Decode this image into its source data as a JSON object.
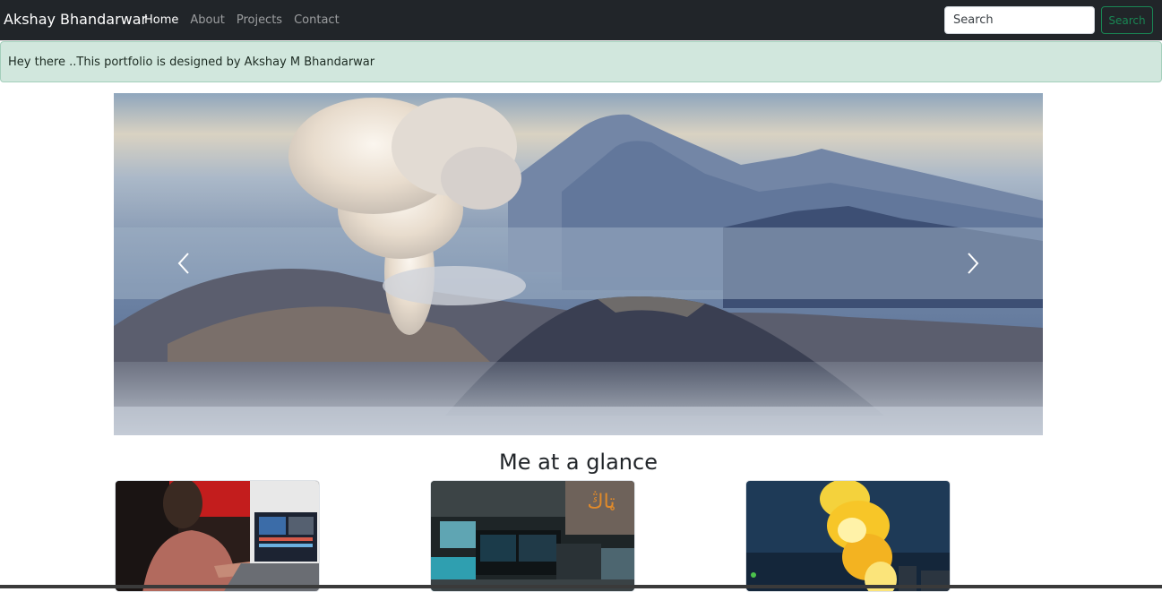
{
  "navbar": {
    "brand": "Akshay Bhandarwar",
    "links": [
      {
        "label": "Home",
        "active": true
      },
      {
        "label": "About",
        "active": false
      },
      {
        "label": "Projects",
        "active": false
      },
      {
        "label": "Contact",
        "active": false
      }
    ],
    "search": {
      "placeholder": "Search",
      "value": "",
      "button_label": "Search"
    }
  },
  "alert": {
    "text": "Hey there ..This portfolio is designed by Akshay M Bhandarwar"
  },
  "carousel": {
    "prev_icon": "chevron-left-icon",
    "next_icon": "chevron-right-icon"
  },
  "glance": {
    "heading": "Me at a glance"
  },
  "colors": {
    "navbar_bg": "#212529",
    "alert_bg": "#d1e7dd",
    "success": "#198754"
  }
}
